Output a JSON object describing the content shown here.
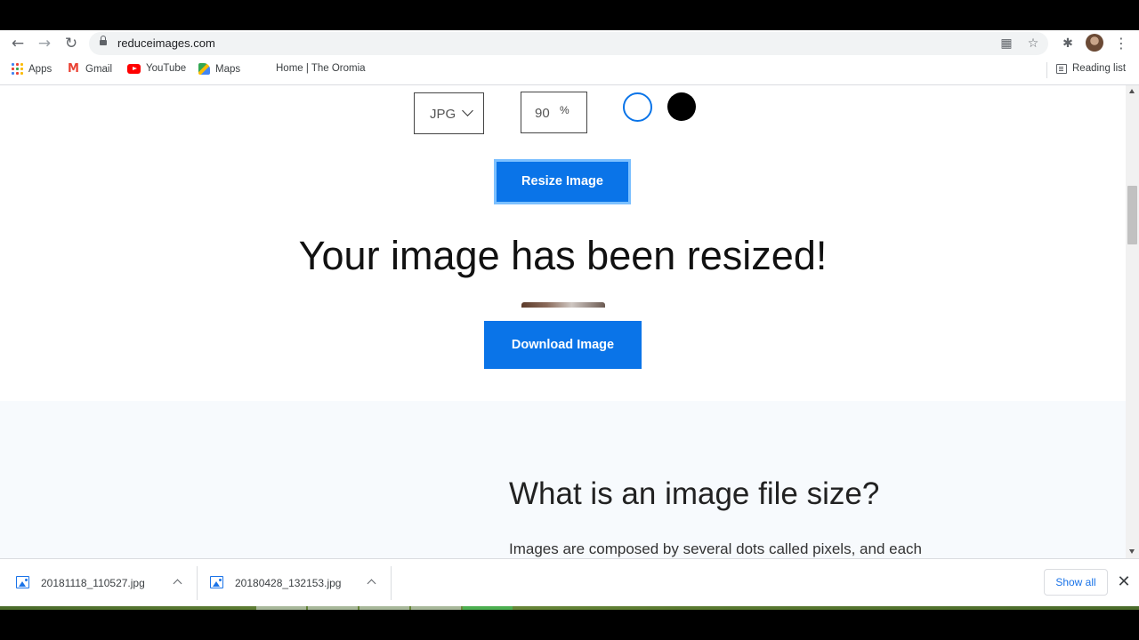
{
  "browser": {
    "url": "reduceimages.com",
    "back_icon": "←",
    "forward_icon": "→",
    "reload_icon": "↻",
    "menu_icon": "⋮",
    "star_icon": "☆",
    "qr_icon": "▦",
    "extensions_icon": "✱",
    "bookmarks": [
      {
        "label": "Apps"
      },
      {
        "label": "Gmail"
      },
      {
        "label": "YouTube"
      },
      {
        "label": "Maps"
      },
      {
        "label": "Home | The Oromia"
      }
    ],
    "reading_list": "Reading list"
  },
  "page": {
    "format_select": {
      "value": "JPG"
    },
    "quality": {
      "value": "90",
      "unit": "%"
    },
    "resize_button": "Resize Image",
    "headline": "Your image has been resized!",
    "download_button": "Download Image",
    "info_title": "What is an image file size?",
    "info_text": "Images are composed by several dots called pixels, and each"
  },
  "downloads": {
    "items": [
      {
        "name": "20181118_110527.jpg"
      },
      {
        "name": "20180428_132153.jpg"
      }
    ],
    "show_all": "Show all",
    "close_icon": "✕"
  },
  "colors": {
    "accent": "#0a74e8",
    "accent_border": "#7cc0ff",
    "selected_color_ring": "#0a74e8"
  }
}
